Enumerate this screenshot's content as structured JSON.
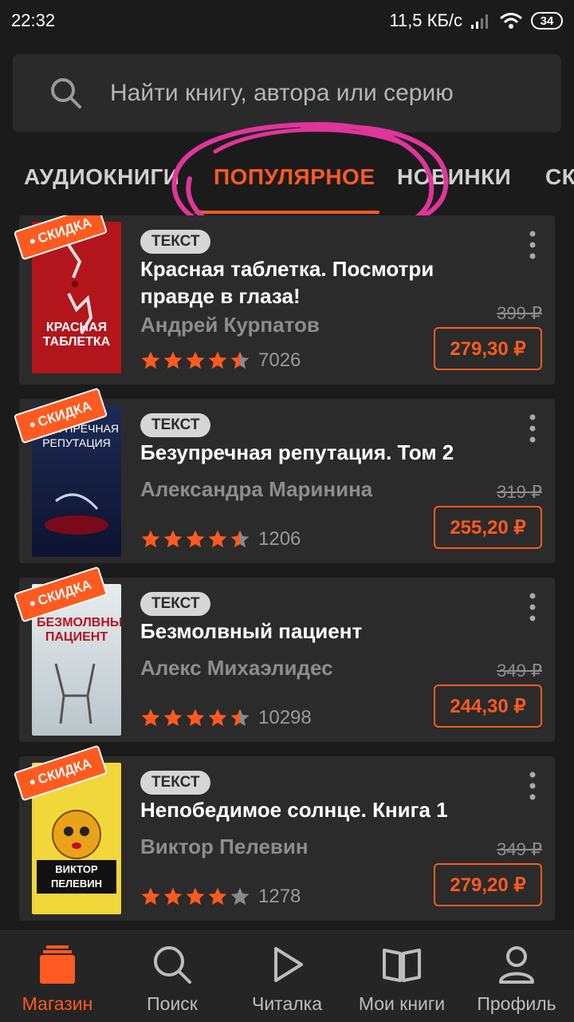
{
  "status_bar": {
    "time": "22:32",
    "network_speed": "11,5 КБ/с",
    "battery": "34"
  },
  "search": {
    "placeholder": "Найти книгу, автора или серию",
    "icon": "search-icon"
  },
  "tabs": [
    {
      "label": "АУДИОКНИГИ",
      "active": false
    },
    {
      "label": "ПОПУЛЯРНОЕ",
      "active": true
    },
    {
      "label": "НОВИНКИ",
      "active": false
    },
    {
      "label": "СК",
      "active": false
    }
  ],
  "colors": {
    "accent": "#ff5a1f",
    "background": "#1b1b1b",
    "card": "#2b2b2b",
    "annotation": "#e0359a"
  },
  "books": [
    {
      "badge": "СКИДКА",
      "type": "ТЕКСТ",
      "title": "Красная таблетка. Посмотри правде в глаза!",
      "author": "Андрей Курпатов",
      "rating": 4.5,
      "rating_count": "7026",
      "old_price": "399 ₽",
      "price": "279,30 ₽",
      "cover_text": "КРАСНАЯ ТАБЛЕТКА"
    },
    {
      "badge": "СКИДКА",
      "type": "ТЕКСТ",
      "title": "Безупречная репутация. Том 2",
      "author": "Александра Маринина",
      "rating": 4.5,
      "rating_count": "1206",
      "old_price": "319 ₽",
      "price": "255,20 ₽",
      "cover_text": "БЕЗУПРЕЧНАЯ РЕПУТАЦИЯ"
    },
    {
      "badge": "СКИДКА",
      "type": "ТЕКСТ",
      "title": "Безмолвный пациент",
      "author": "Алекс Михаэлидес",
      "rating": 4.5,
      "rating_count": "10298",
      "old_price": "349 ₽",
      "price": "244,30 ₽",
      "cover_text": "БЕЗМОЛВНЫЙ ПАЦИЕНТ"
    },
    {
      "badge": "СКИДКА",
      "type": "ТЕКСТ",
      "title": "Непобедимое солнце. Книга 1",
      "author": "Виктор Пелевин",
      "rating": 4,
      "rating_count": "1278",
      "old_price": "349 ₽",
      "price": "279,20 ₽",
      "cover_text": "ВИКТОР ПЕЛЕВИН"
    }
  ],
  "bottom_nav": [
    {
      "label": "Магазин",
      "icon": "store-icon",
      "active": true
    },
    {
      "label": "Поиск",
      "icon": "search-icon",
      "active": false
    },
    {
      "label": "Читалка",
      "icon": "play-icon",
      "active": false
    },
    {
      "label": "Мои книги",
      "icon": "book-icon",
      "active": false
    },
    {
      "label": "Профиль",
      "icon": "person-icon",
      "active": false
    }
  ]
}
